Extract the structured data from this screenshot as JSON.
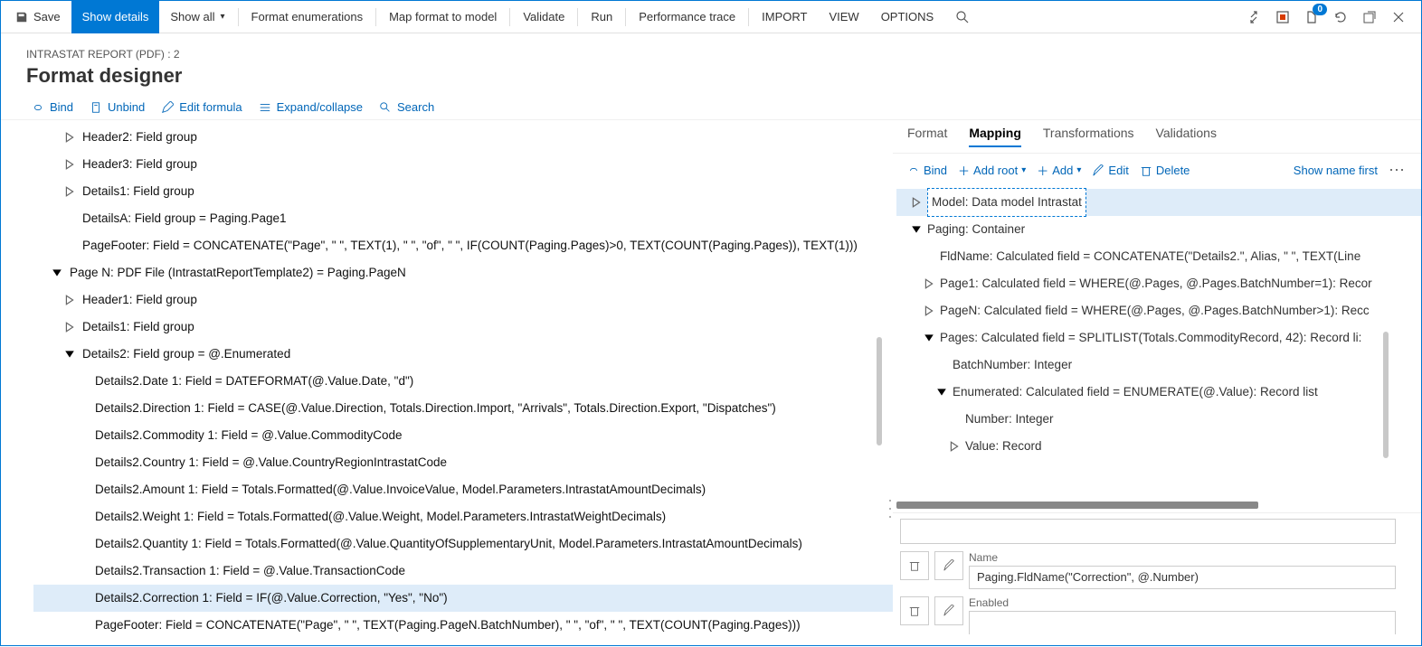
{
  "toolbar": {
    "save": "Save",
    "show_details": "Show details",
    "show_all": "Show all",
    "format_enum": "Format enumerations",
    "map_format": "Map format to model",
    "validate": "Validate",
    "run": "Run",
    "perf": "Performance trace",
    "import": "IMPORT",
    "view": "VIEW",
    "options": "OPTIONS",
    "badge": "0"
  },
  "header": {
    "crumb": "INTRASTAT REPORT (PDF) : 2",
    "title": "Format designer"
  },
  "actions": {
    "bind": "Bind",
    "unbind": "Unbind",
    "edit_formula": "Edit formula",
    "expand": "Expand/collapse",
    "search": "Search"
  },
  "tree": [
    {
      "indent": 1,
      "tw": "r",
      "text": "Header2: Field group"
    },
    {
      "indent": 1,
      "tw": "r",
      "text": "Header3: Field group"
    },
    {
      "indent": 1,
      "tw": "r",
      "text": "Details1: Field group"
    },
    {
      "indent": 1,
      "tw": "",
      "text": "DetailsA: Field group = Paging.Page1"
    },
    {
      "indent": 1,
      "tw": "",
      "text": "PageFooter: Field = CONCATENATE(\"Page\", \" \", TEXT(1), \" \", \"of\", \" \", IF(COUNT(Paging.Pages)>0, TEXT(COUNT(Paging.Pages)), TEXT(1)))"
    },
    {
      "indent": 0,
      "tw": "d",
      "text": "Page N: PDF File (IntrastatReportTemplate2) = Paging.PageN"
    },
    {
      "indent": 1,
      "tw": "r",
      "text": "Header1: Field group"
    },
    {
      "indent": 1,
      "tw": "r",
      "text": "Details1: Field group"
    },
    {
      "indent": 1,
      "tw": "d",
      "text": "Details2: Field group = @.Enumerated"
    },
    {
      "indent": 2,
      "tw": "",
      "text": "Details2.Date 1: Field = DATEFORMAT(@.Value.Date, \"d\")"
    },
    {
      "indent": 2,
      "tw": "",
      "text": "Details2.Direction 1: Field = CASE(@.Value.Direction, Totals.Direction.Import, \"Arrivals\", Totals.Direction.Export, \"Dispatches\")"
    },
    {
      "indent": 2,
      "tw": "",
      "text": "Details2.Commodity 1: Field = @.Value.CommodityCode"
    },
    {
      "indent": 2,
      "tw": "",
      "text": "Details2.Country 1: Field = @.Value.CountryRegionIntrastatCode"
    },
    {
      "indent": 2,
      "tw": "",
      "text": "Details2.Amount 1: Field = Totals.Formatted(@.Value.InvoiceValue, Model.Parameters.IntrastatAmountDecimals)"
    },
    {
      "indent": 2,
      "tw": "",
      "text": "Details2.Weight 1: Field = Totals.Formatted(@.Value.Weight, Model.Parameters.IntrastatWeightDecimals)"
    },
    {
      "indent": 2,
      "tw": "",
      "text": "Details2.Quantity 1: Field = Totals.Formatted(@.Value.QuantityOfSupplementaryUnit, Model.Parameters.IntrastatAmountDecimals)"
    },
    {
      "indent": 2,
      "tw": "",
      "text": "Details2.Transaction 1: Field = @.Value.TransactionCode"
    },
    {
      "indent": 2,
      "tw": "",
      "text": "Details2.Correction 1: Field = IF(@.Value.Correction, \"Yes\", \"No\")",
      "sel": true
    },
    {
      "indent": 2,
      "tw": "",
      "text": "PageFooter: Field = CONCATENATE(\"Page\", \" \", TEXT(Paging.PageN.BatchNumber), \" \", \"of\", \" \", TEXT(COUNT(Paging.Pages)))"
    }
  ],
  "rtabs": {
    "format": "Format",
    "mapping": "Mapping",
    "trans": "Transformations",
    "valid": "Validations"
  },
  "rtoolbar": {
    "bind": "Bind",
    "addroot": "Add root",
    "add": "Add",
    "edit": "Edit",
    "delete": "Delete",
    "showname": "Show name first"
  },
  "rtree": [
    {
      "indent": 0,
      "tw": "r",
      "text": "Model: Data model Intrastat",
      "sel": true
    },
    {
      "indent": 0,
      "tw": "d",
      "text": "Paging: Container"
    },
    {
      "indent": 1,
      "tw": "",
      "text": "FldName: Calculated field = CONCATENATE(\"Details2.\", Alias, \" \", TEXT(Line"
    },
    {
      "indent": 1,
      "tw": "r",
      "text": "Page1: Calculated field = WHERE(@.Pages, @.Pages.BatchNumber=1): Recor"
    },
    {
      "indent": 1,
      "tw": "r",
      "text": "PageN: Calculated field = WHERE(@.Pages, @.Pages.BatchNumber>1): Recc"
    },
    {
      "indent": 1,
      "tw": "d",
      "text": "Pages: Calculated field = SPLITLIST(Totals.CommodityRecord, 42): Record li:"
    },
    {
      "indent": 2,
      "tw": "",
      "text": "BatchNumber: Integer"
    },
    {
      "indent": 2,
      "tw": "d",
      "text": "Enumerated: Calculated field = ENUMERATE(@.Value): Record list"
    },
    {
      "indent": 3,
      "tw": "",
      "text": "Number: Integer"
    },
    {
      "indent": 3,
      "tw": "r",
      "text": "Value: Record"
    }
  ],
  "props": {
    "name_label": "Name",
    "name_value": "Paging.FldName(\"Correction\", @.Number)",
    "enabled_label": "Enabled"
  }
}
